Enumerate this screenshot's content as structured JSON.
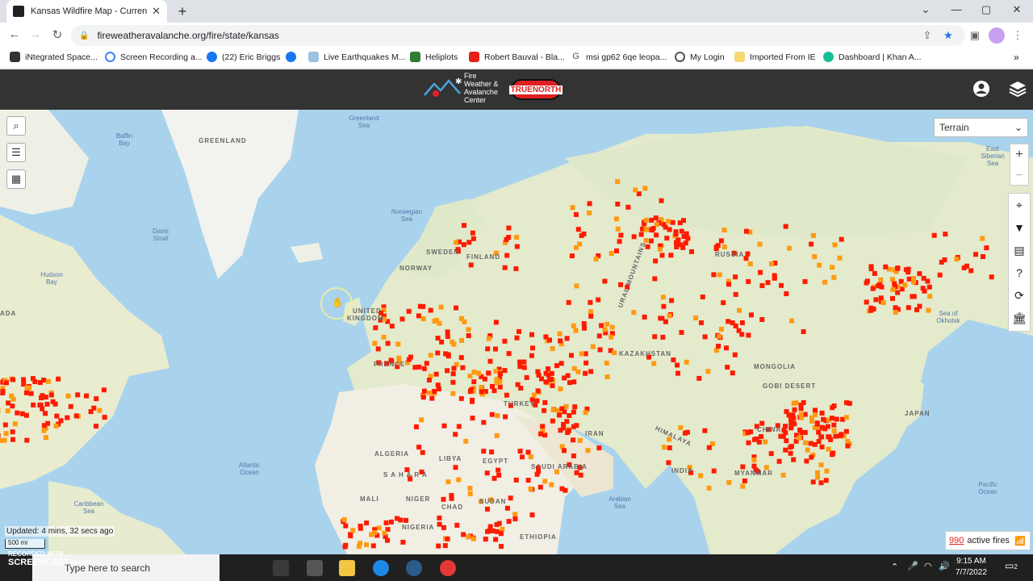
{
  "browser": {
    "tab_title": "Kansas Wildfire Map - Current Ka",
    "url": "fireweatheravalanche.org/fire/state/kansas",
    "bookmarks": [
      "iNtegrated Space...",
      "Screen Recording a...",
      "(22) Eric Briggs",
      "",
      "Live Earthquakes M...",
      "Heliplots",
      "Robert Bauval - Bla...",
      "msi gp62 6qe leopa...",
      "My Login",
      "Imported From IE",
      "Dashboard | Khan A..."
    ]
  },
  "header": {
    "logo_line1": "Fire",
    "logo_line2": "Weather &",
    "logo_line3": "Avalanche",
    "logo_line4": "Center",
    "partner": "TRUENORTH"
  },
  "map": {
    "basemap_select": "Terrain",
    "labels": {
      "greenland": "GREENLAND",
      "sweden": "SWEDEN",
      "norway": "NORWAY",
      "finland": "FINLAND",
      "russia": "RUSSIA",
      "uk1": "UNITED",
      "uk2": "KINGDOM",
      "kazakhstan": "KAZAKHSTAN",
      "mongolia": "MONGOLIA",
      "gobi": "GOBI DESERT",
      "france": "FRANCE",
      "turkey": "TURKEY",
      "iran": "IRAN",
      "algeria": "ALGERIA",
      "libya": "LIBYA",
      "egypt": "EGYPT",
      "sahara": "S A H A R A",
      "arabia": "SAUDI ARABIA",
      "india": "INDIA",
      "china": "CHINA",
      "japan": "JAPAN",
      "mali": "MALI",
      "niger": "NIGER",
      "chad": "CHAD",
      "sudan": "SUDAN",
      "ethiopia": "ETHIOPIA",
      "nigeria": "NIGERIA",
      "canada": "ADA",
      "myanmar": "MYANMAR",
      "ural": "URAL MOUNTAINS",
      "himalaya": "HIMALAYA"
    },
    "oceans": {
      "atlantic": "Atlantic Ocean",
      "pacific": "Pacific Ocean",
      "arabian": "Arabian Sea",
      "norwegian": "Norwegian Sea",
      "baffin": "Baffin Bay",
      "hudson": "Hudson Bay",
      "davis": "Davis Strait",
      "greenland_sea": "Greenland Sea",
      "caribbean": "Caribbean Sea",
      "okhotsk": "Sea of Okhotsk",
      "east_siberian": "East Siberian Sea"
    },
    "updated": "Updated: 4 mins, 32 secs ago",
    "scale": "500 mi",
    "active_count": "990",
    "active_label": "active fires"
  },
  "taskbar": {
    "search_placeholder": "Type here to search",
    "time": "9:15 AM",
    "date": "7/7/2022",
    "notif_count": "2"
  },
  "watermark": {
    "line1": "RECORDED WITH",
    "line2": "SCREENCAST",
    "line3": "MATIC"
  }
}
